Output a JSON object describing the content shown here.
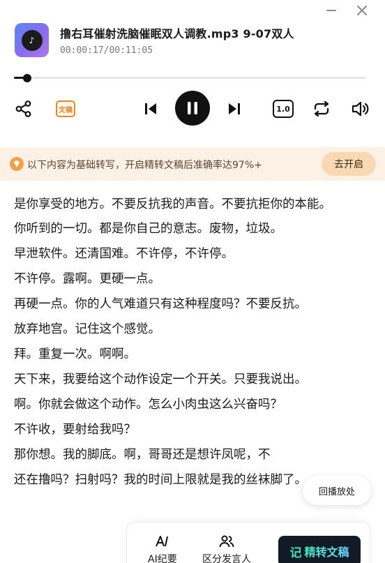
{
  "window": {
    "minimize_icon": "minimize-icon",
    "close_icon": "close-icon"
  },
  "player": {
    "title": "撸右耳催射洗脑催眠双人调教.mp3  9-07双人",
    "time": "00:00:17/00:11:05",
    "progress_fraction": 0.026,
    "thumbnail_icon": "music-disc-icon"
  },
  "controls": {
    "share_icon": "share-icon",
    "wengao_label": "文稿",
    "prev_icon": "skip-previous-icon",
    "pause_icon": "pause-icon",
    "next_icon": "skip-next-icon",
    "speed_label": "1.0",
    "loop_icon": "repeat-icon",
    "volume_icon": "volume-icon"
  },
  "banner": {
    "text": "以下内容为基础转写，开启精转文稿后准确率达97%+",
    "button": "去开启",
    "color": "#fdf1e6"
  },
  "transcript": [
    "是你享受的地方。不要反抗我的声音。不要抗拒你的本能。",
    "你听到的一切。都是你自己的意志。废物，垃圾。",
    "早泄软件。还清国难。不许停，不许停。",
    "不许停。露啊。更硬一点。",
    "再硬一点。你的人气难道只有这种程度吗？不要反抗。",
    "放弃地宫。记住这个感觉。",
    "拜。重复一次。啊啊。",
    "天下来，我要给这个动作设定一个开关。只要我说出。",
    "啊。你就会做这个动作。怎么小肉虫这么兴奋吗？",
    "不许收，要射给我吗？",
    "那你想。我的脚底。啊，哥哥还是想许凤呢，不",
    "还在撸吗？扫射吗？我的时间上限就是我的丝袜脚了。"
  ],
  "jump_button": "回播放处",
  "bottom_bar": {
    "ai_label": "AI纪要",
    "speaker_label": "区分发言人",
    "main_icon": "记",
    "main_label": "精转文稿"
  }
}
